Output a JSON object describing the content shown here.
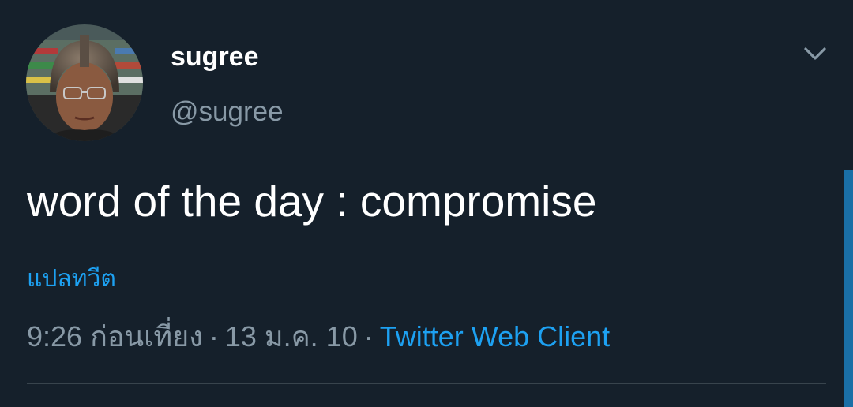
{
  "user": {
    "display_name": "sugree",
    "handle": "@sugree"
  },
  "tweet": {
    "text": "word of the day : compromise",
    "translate_label": "แปลทวีต",
    "time": "9:26 ก่อนเที่ยง",
    "separator": "·",
    "date": "13 ม.ค. 10",
    "source": "Twitter Web Client"
  },
  "colors": {
    "background": "#15202b",
    "link": "#1da1f2",
    "muted": "#8899a6"
  },
  "icons": {
    "caret": "chevron-down-icon"
  }
}
